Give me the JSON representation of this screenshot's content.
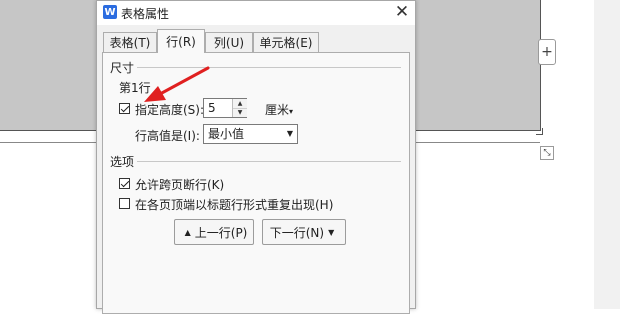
{
  "dialog": {
    "title": "表格属性",
    "app_icon_letter": "W",
    "close_glyph": "✕"
  },
  "tabs": [
    {
      "label": "表格(T)",
      "active": false
    },
    {
      "label": "行(R)",
      "active": true
    },
    {
      "label": "列(U)",
      "active": false
    },
    {
      "label": "单元格(E)",
      "active": false
    }
  ],
  "size_section": {
    "heading": "尺寸",
    "row_label": "第1行",
    "specify_height": {
      "label": "指定高度(S):",
      "checked": true
    },
    "height_value": "5",
    "unit": "厘米",
    "unit_arrow": "▾",
    "row_height_is": {
      "label": "行高值是(I):",
      "value": "最小值",
      "arrow": "▼"
    }
  },
  "options_section": {
    "heading": "选项",
    "allow_break": {
      "label": "允许跨页断行(K)",
      "checked": true
    },
    "repeat_header": {
      "label": "在各页顶端以标题行形式重复出现(H)",
      "checked": false
    }
  },
  "nav_buttons": {
    "prev": {
      "label": "上一行(P)",
      "glyph": "▲"
    },
    "next": {
      "label": "下一行(N)",
      "glyph": "▼"
    }
  },
  "background": {
    "add_column_glyph": "+",
    "resize_glyph": "⤡"
  },
  "colors": {
    "accent_blue": "#2b6ce0",
    "annotation_red": "#e02020",
    "table_gray": "#c6c6c6"
  }
}
